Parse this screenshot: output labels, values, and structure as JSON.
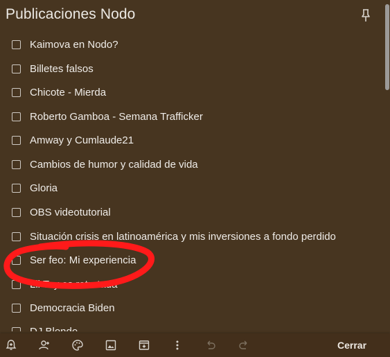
{
  "title": "Publicaciones Nodo",
  "items": [
    {
      "label": "Kaimova en Nodo?",
      "checked": false
    },
    {
      "label": "Billetes falsos",
      "checked": false
    },
    {
      "label": "Chicote - Mierda",
      "checked": false
    },
    {
      "label": "Roberto Gamboa - Semana Trafficker",
      "checked": false
    },
    {
      "label": "Amway y Cumlaude21",
      "checked": false
    },
    {
      "label": "Cambios de humor y calidad de vida",
      "checked": false
    },
    {
      "label": "Gloria",
      "checked": false
    },
    {
      "label": "OBS videotutorial",
      "checked": false
    },
    {
      "label": "Situación crisis en latinoamérica y mis inversiones a fondo perdido",
      "checked": false
    },
    {
      "label": "Ser feo: Mi experiencia",
      "checked": false
    },
    {
      "label": "Lil Tay es retratada",
      "checked": false
    },
    {
      "label": "Democracia Biden",
      "checked": false
    },
    {
      "label": "DJ Blondo",
      "checked": false
    }
  ],
  "toolbar": {
    "icons": [
      "bell-plus-icon",
      "person-add-icon",
      "palette-icon",
      "image-icon",
      "archive-icon",
      "more-vert-icon",
      "undo-icon",
      "redo-icon"
    ],
    "close_label": "Cerrar"
  },
  "colors": {
    "background": "#473520",
    "toolbar": "#432f1b",
    "annotation": "#ff1a1a"
  }
}
